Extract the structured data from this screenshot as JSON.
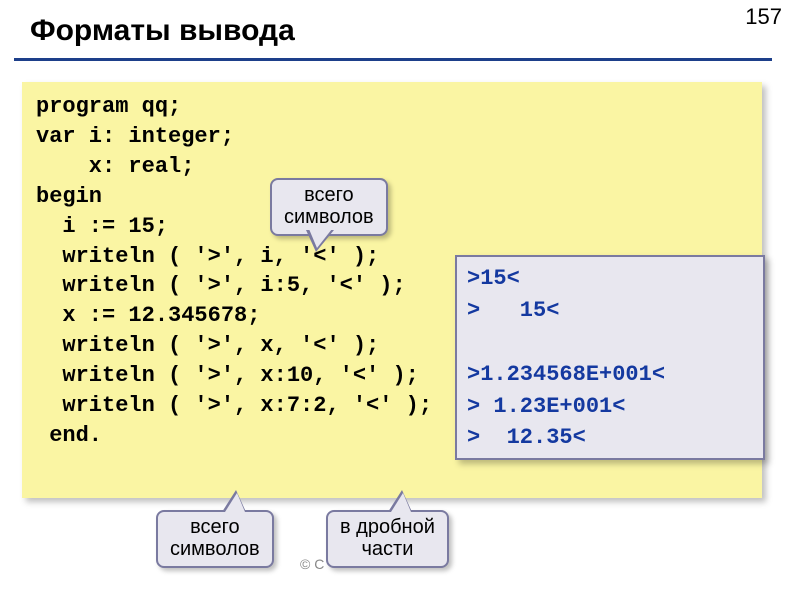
{
  "page_number": "157",
  "title": "Форматы вывода",
  "code": "program qq;\nvar i: integer;\n    x: real;\nbegin\n  i := 15;\n  writeln ( '>', i, '<' );\n  writeln ( '>', i:5, '<' );\n  x := 12.345678;\n  writeln ( '>', x, '<' );\n  writeln ( '>', x:10, '<' );\n  writeln ( '>', x:7:2, '<' );\n end.",
  "output": ">15<\n>   15<\n\n>1.234568E+001<\n> 1.23E+001<\n>  12.35<",
  "callouts": {
    "top": "всего\nсимволов",
    "bottom_left": "всего\nсимволов",
    "bottom_right": "в дробной\nчасти"
  },
  "footer": "© C"
}
